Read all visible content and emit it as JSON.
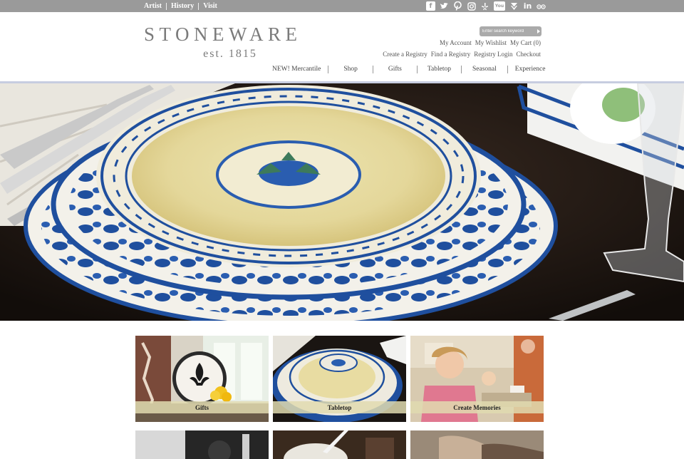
{
  "topbar": {
    "links": [
      "Artist",
      "History",
      "Visit"
    ],
    "social_icons": [
      "facebook-icon",
      "twitter-icon",
      "pinterest-icon",
      "instagram-icon",
      "yelp-icon",
      "youtube-icon",
      "foursquare-icon",
      "linkedin-icon",
      "tripadvisor-icon"
    ]
  },
  "header": {
    "logo_name": "STONEWARE",
    "logo_est": "est. 1815",
    "search_placeholder": "Enter search keyword",
    "account_links": [
      "My Account",
      "My Wishlist",
      "My Cart (0)"
    ],
    "registry_links": [
      "Create a Registry",
      "Find a Registry",
      "Registry Login",
      "Checkout"
    ]
  },
  "nav": {
    "items": [
      "NEW! Mercantile",
      "Shop",
      "Gifts",
      "Tabletop",
      "Seasonal",
      "Experience"
    ]
  },
  "hero": {
    "image": "stacked blue and yellow stoneware dinner plates on a dark table"
  },
  "tiles": [
    {
      "label": "Gifts"
    },
    {
      "label": "Tabletop"
    },
    {
      "label": "Create Memories"
    }
  ],
  "colors": {
    "topbar": "#9a9a9a",
    "rule": "#c7cde0",
    "accent_blue": "#1f4f9e",
    "caption": "#e0dab0"
  }
}
